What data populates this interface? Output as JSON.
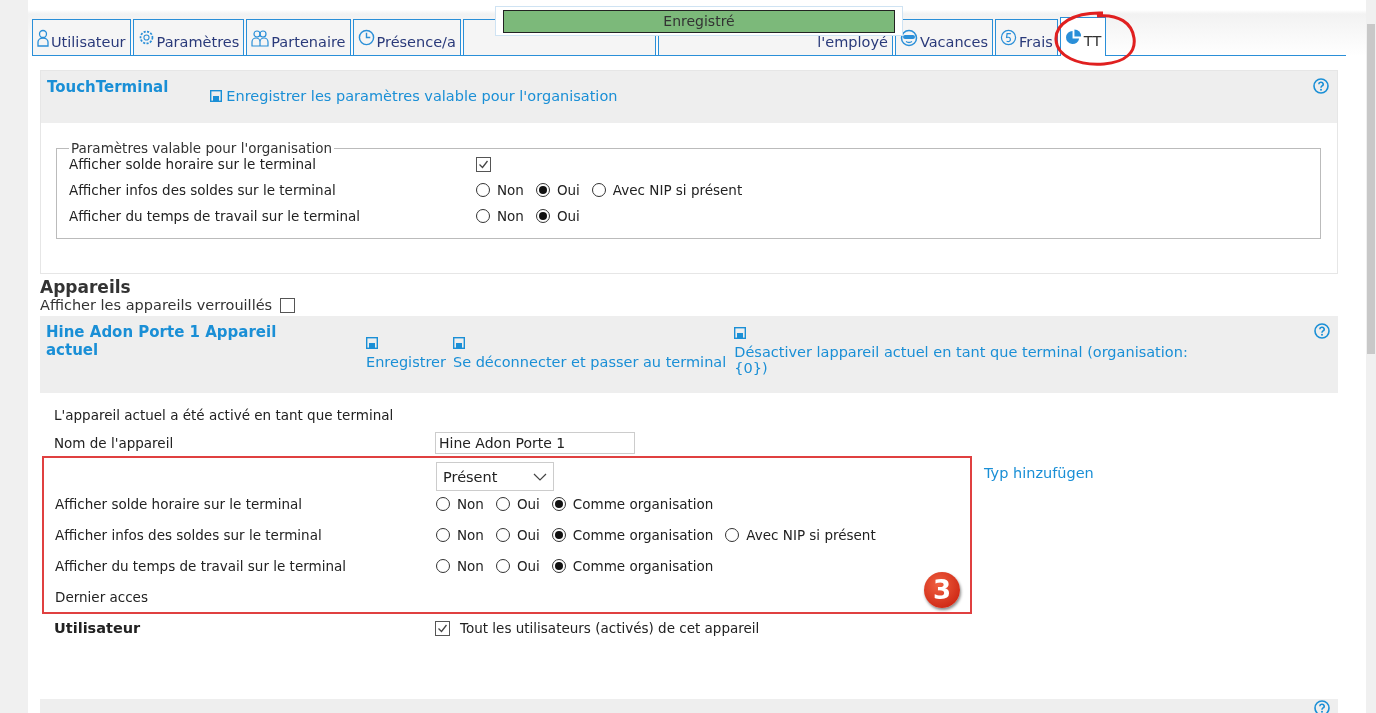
{
  "toast": {
    "text": "Enregistré"
  },
  "tabs": [
    {
      "label": "Utilisateur",
      "selected": false
    },
    {
      "label": "Paramètres",
      "selected": false
    },
    {
      "label": "Partenaire",
      "selected": false
    },
    {
      "label": "Présence/a",
      "selected": false
    },
    {
      "selected": false
    },
    {
      "label": "l'employé",
      "selected": false
    },
    {
      "label": "Vacances",
      "selected": false
    },
    {
      "label": "Frais",
      "selected": false
    },
    {
      "label": "TT",
      "selected": true
    }
  ],
  "touch_terminal": {
    "title": "TouchTerminal",
    "save_link": "Enregistrer les paramètres valable pour l'organisation",
    "legend": "Paramètres valable pour l'organisation",
    "rows": [
      {
        "kind": "checkbox",
        "label": "Afficher solde horaire sur le terminal",
        "checked": true
      },
      {
        "kind": "radio",
        "label": "Afficher infos des soldes sur le terminal",
        "options": [
          {
            "label": "Non",
            "selected": false
          },
          {
            "label": "Oui",
            "selected": true
          },
          {
            "label": "Avec NIP si présent",
            "selected": false
          }
        ]
      },
      {
        "kind": "radio",
        "label": "Afficher du temps de travail sur le terminal",
        "options": [
          {
            "label": "Non",
            "selected": false
          },
          {
            "label": "Oui",
            "selected": true
          }
        ]
      }
    ]
  },
  "devices": {
    "title": "Appareils",
    "show_locked": {
      "label": "Afficher les appareils verrouillés",
      "checked": false
    },
    "device": {
      "title": "Hine Adon Porte 1 Appareil actuel",
      "actions": [
        "Enregistrer",
        "Se déconnecter et passer au terminal",
        "Désactiver lappareil actuel en tant que terminal (organisation: {0})"
      ],
      "status": "L'appareil actuel a été activé en tant que terminal",
      "name_field": {
        "label": "Nom de l'appareil",
        "value": "Hine Adon Porte 1"
      },
      "type_select": {
        "value": "Présent"
      },
      "add_type_link": "Typ hinzufügen",
      "rows": [
        {
          "kind": "radio",
          "label": "Afficher solde horaire sur le terminal",
          "options": [
            {
              "label": "Non",
              "selected": false
            },
            {
              "label": "Oui",
              "selected": false
            },
            {
              "label": "Comme organisation",
              "selected": true
            }
          ]
        },
        {
          "kind": "radio",
          "label": "Afficher infos des soldes sur le terminal",
          "options": [
            {
              "label": "Non",
              "selected": false
            },
            {
              "label": "Oui",
              "selected": false
            },
            {
              "label": "Comme organisation",
              "selected": true
            },
            {
              "label": "Avec NIP si présent",
              "selected": false
            }
          ]
        },
        {
          "kind": "radio",
          "label": "Afficher du temps de travail sur le terminal",
          "options": [
            {
              "label": "Non",
              "selected": false
            },
            {
              "label": "Oui",
              "selected": false
            },
            {
              "label": "Comme organisation",
              "selected": true
            }
          ]
        },
        {
          "kind": "text",
          "label": "Dernier acces"
        }
      ],
      "badge": "3",
      "users": {
        "label": "Utilisateur",
        "checked": true,
        "text": "Tout les utilisateurs (activés) de cet appareil"
      }
    }
  }
}
